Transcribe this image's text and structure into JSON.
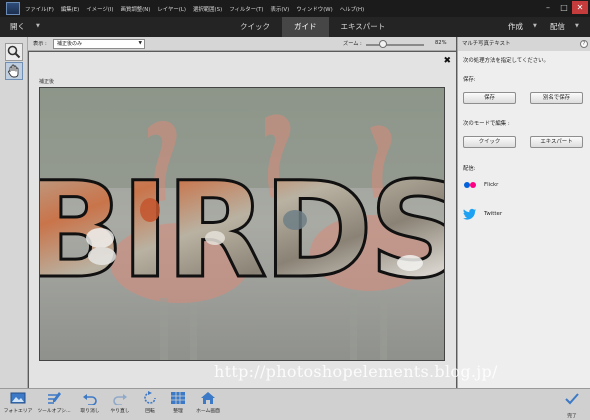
{
  "menubar": {
    "items": [
      "ファイル(F)",
      "編集(E)",
      "イメージ(I)",
      "画質調整(N)",
      "レイヤー(L)",
      "選択範囲(S)",
      "フィルター(T)",
      "表示(V)",
      "ウィンドウ(W)",
      "ヘルプ(H)"
    ],
    "window_controls": [
      "–",
      "□",
      "✕"
    ]
  },
  "modebar": {
    "open_label": "開く",
    "tabs": [
      {
        "label": "クイック",
        "active": false
      },
      {
        "label": "ガイド",
        "active": true
      },
      {
        "label": "エキスパート",
        "active": false
      }
    ],
    "create_label": "作成",
    "share_label": "配信"
  },
  "options": {
    "view_label": "表示 :",
    "view_value": "補正後のみ",
    "zoom_label": "ズーム :",
    "zoom_value": "82%",
    "zoom_fraction": 0.3
  },
  "tools": [
    {
      "icon": "zoom-tool-icon",
      "selected": false
    },
    {
      "icon": "hand-tool-icon",
      "selected": true
    }
  ],
  "canvas": {
    "after_label": "補正後",
    "photo_text": "BIRDS"
  },
  "panel": {
    "title": "マルチ写真テキスト",
    "instruction": "次の処理方法を指定してください。",
    "save_heading": "保存:",
    "save_button": "保存",
    "save_as_button": "別名で保存",
    "edit_heading": "次のモードで編集 :",
    "quick_button": "クイック",
    "expert_button": "エキスパート",
    "share_heading": "配信:",
    "flickr_label": "Flickr",
    "twitter_label": "Twitter"
  },
  "bottombar": {
    "items": [
      {
        "label": "フォトエリア",
        "icon": "photo-bin-icon"
      },
      {
        "label": "ツールオプシ...",
        "icon": "tool-options-icon"
      },
      {
        "label": "取り消し",
        "icon": "undo-icon"
      },
      {
        "label": "やり直し",
        "icon": "redo-icon"
      },
      {
        "label": "回転",
        "icon": "rotate-icon"
      },
      {
        "label": "整理",
        "icon": "organize-icon"
      },
      {
        "label": "ホーム画面",
        "icon": "home-icon"
      }
    ],
    "done_label": "完了"
  },
  "watermark": "http://photoshopelements.blog.jp/",
  "colors": {
    "menubar": "#1b1b1b",
    "modebar": "#242424",
    "active_tab": "#464646",
    "panel": "#eeeeee",
    "flamingo": "#d98b7a",
    "flickr_pink": "#ff0084",
    "flickr_blue": "#0063dc",
    "twitter_blue": "#1da1f2"
  }
}
